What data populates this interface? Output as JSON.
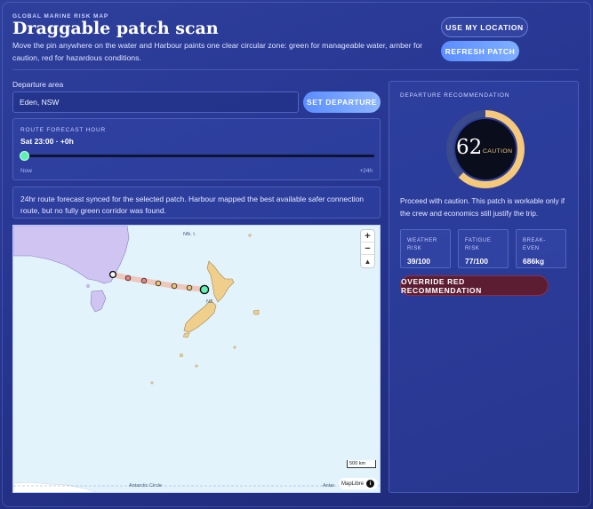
{
  "header": {
    "kicker": "GLOBAL MARINE RISK MAP",
    "title": "Draggable patch scan",
    "subtitle": "Move the pin anywhere on the water and Harbour paints one clear circular zone: green for manageable water, amber for caution, red for hazardous conditions.",
    "use_location_label": "USE MY LOCATION",
    "refresh_label": "REFRESH PATCH"
  },
  "departure": {
    "label": "Departure area",
    "value": "Eden, NSW",
    "set_label": "SET DEPARTURE"
  },
  "forecast": {
    "label": "ROUTE FORECAST HOUR",
    "value": "Sat 23:00 · +0h",
    "slider_fraction": 0,
    "min_label": "Now",
    "max_label": "+24h"
  },
  "note": "24hr route forecast synced for the selected patch. Harbour mapped the best available safer connection route, but no fully green corridor was found.",
  "map": {
    "label_nfk": "Nfk. I.",
    "label_nz": "NZ",
    "antarctic_left": "Antarctic Circle",
    "antarctic_right": "Antar",
    "scale_label": "500 km",
    "attribution": "MapLibre",
    "info_glyph": "i",
    "zoom_in": "+",
    "zoom_out": "−",
    "compass": "▲",
    "colors": {
      "land": "#f0cf8d",
      "land_au": "#cfc4f2",
      "water": "#e3f3fc",
      "route": "#f3b8a6"
    }
  },
  "recommendation": {
    "label": "DEPARTURE RECOMMENDATION",
    "score": "62",
    "band": "CAUTION",
    "score_fraction": 0.62,
    "advice": "Proceed with caution. This patch is workable only if the crew and economics still justify the trip.",
    "metrics": [
      {
        "label": "WEATHER RISK",
        "value": "39/100"
      },
      {
        "label": "FATIGUE RISK",
        "value": "77/100"
      },
      {
        "label": "BREAK-EVEN",
        "value": "686kg"
      }
    ],
    "override_label": "OVERRIDE RED RECOMMENDATION",
    "colors": {
      "gauge": "#f6c87a",
      "gauge_track": "#3a4a8c",
      "caution": "#f3c879",
      "override": "#5c1d33"
    }
  }
}
